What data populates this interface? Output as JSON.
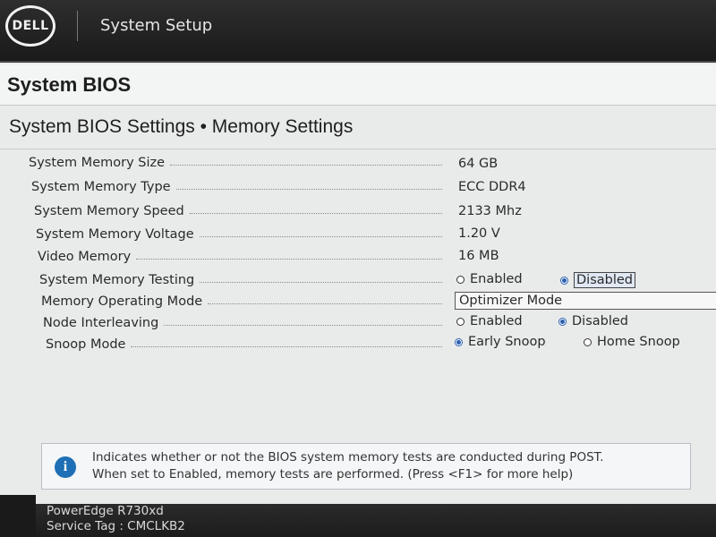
{
  "header": {
    "logo_text": "DELL",
    "app_title": "System Setup"
  },
  "section": {
    "title": "System BIOS"
  },
  "page": {
    "title": "System BIOS Settings • Memory Settings"
  },
  "settings": {
    "rows": [
      {
        "label": "System Memory Size",
        "value": "64 GB"
      },
      {
        "label": "System Memory Type",
        "value": "ECC DDR4"
      },
      {
        "label": "System Memory Speed",
        "value": "2133 Mhz"
      },
      {
        "label": "System Memory Voltage",
        "value": "1.20 V"
      },
      {
        "label": "Video Memory",
        "value": "16 MB"
      },
      {
        "label": "System Memory Testing",
        "options": [
          "Enabled",
          "Disabled"
        ],
        "selected": "Disabled"
      },
      {
        "label": "Memory Operating Mode",
        "value": "Optimizer Mode"
      },
      {
        "label": "Node Interleaving",
        "options": [
          "Enabled",
          "Disabled"
        ],
        "selected": "Disabled"
      },
      {
        "label": "Snoop Mode",
        "options": [
          "Early Snoop",
          "Home Snoop"
        ],
        "selected": "Early Snoop"
      }
    ]
  },
  "help": {
    "line1": "Indicates whether or not the BIOS system memory tests are conducted during POST.",
    "line2": "When set to Enabled, memory tests are performed. (Press <F1> for more help)"
  },
  "footer": {
    "model": "PowerEdge R730xd",
    "service_tag": "Service Tag : CMCLKB2"
  },
  "colors": {
    "accent": "#2a5fb0",
    "header_bg": "#1a1a1a",
    "info_icon": "#1e6fb5"
  }
}
